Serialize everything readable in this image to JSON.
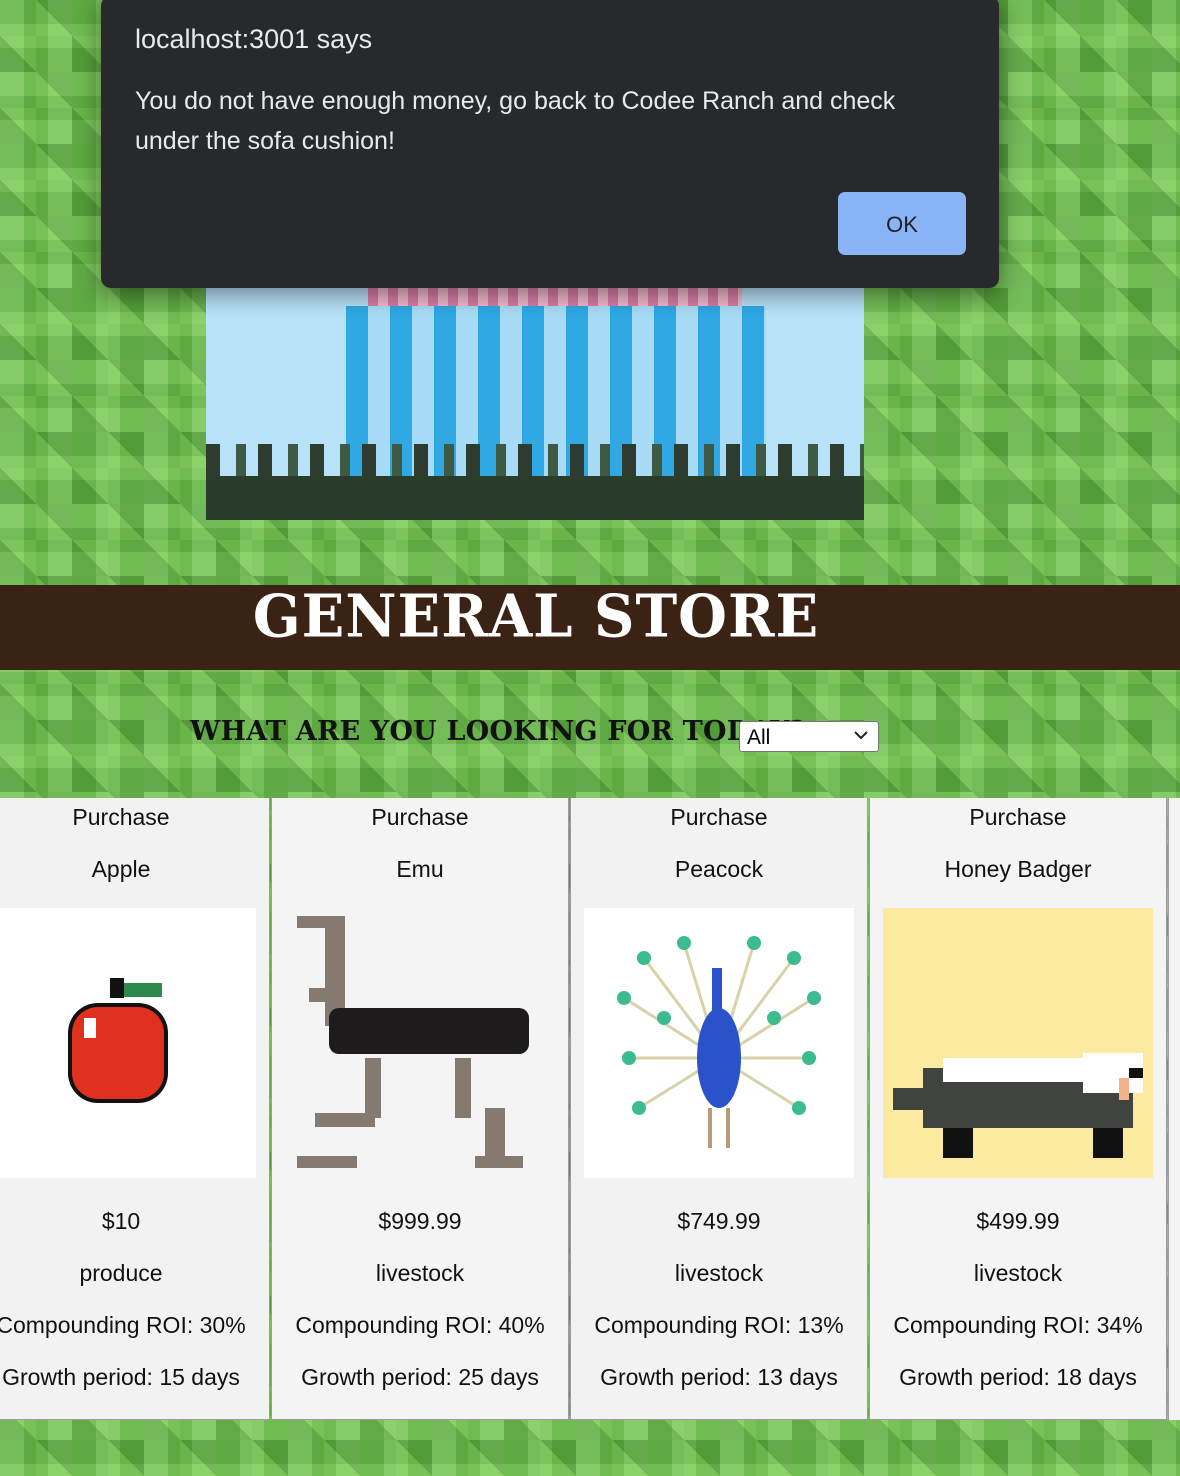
{
  "alert": {
    "title": "localhost:3001 says",
    "message": "You do not have enough money, go back to Codee Ranch and check under the sofa cushion!",
    "ok_label": "OK"
  },
  "store": {
    "title": "GENERAL STORE",
    "filter_label": "WHAT ARE YOU LOOKING FOR TODAY?",
    "filter_value": "All"
  },
  "products": [
    {
      "action": "Purchase",
      "name": "Apple",
      "price": "$10",
      "category": "produce",
      "roi": "Compounding ROI: 30%",
      "growth": "Growth period: 15 days",
      "image_icon": "apple-icon"
    },
    {
      "action": "Purchase",
      "name": "Emu",
      "price": "$999.99",
      "category": "livestock",
      "roi": "Compounding ROI: 40%",
      "growth": "Growth period: 25 days",
      "image_icon": "emu-icon"
    },
    {
      "action": "Purchase",
      "name": "Peacock",
      "price": "$749.99",
      "category": "livestock",
      "roi": "Compounding ROI: 13%",
      "growth": "Growth period: 13 days",
      "image_icon": "peacock-icon"
    },
    {
      "action": "Purchase",
      "name": "Honey Badger",
      "price": "$499.99",
      "category": "livestock",
      "roi": "Compounding ROI: 34%",
      "growth": "Growth period: 18 days",
      "image_icon": "honey-badger-icon"
    }
  ]
}
